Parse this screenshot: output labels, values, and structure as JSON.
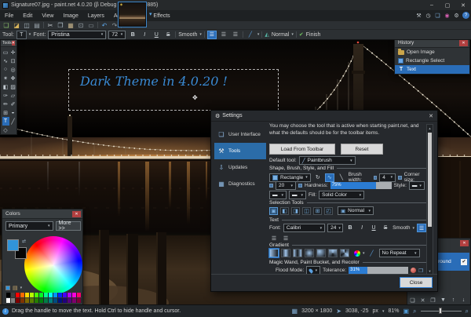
{
  "titlebar": {
    "title": "Signature07.jpg - paint.net 4.0.20 (β Debug 4.20.6554.3885)",
    "minimize": "–",
    "maximize": "▢",
    "close": "✕"
  },
  "tab": {
    "unsaved": "✶",
    "chevron": "▾"
  },
  "menu": {
    "items": [
      "File",
      "Edit",
      "View",
      "Image",
      "Layers",
      "Adjustments",
      "Effects"
    ]
  },
  "utility": {
    "glyphs": [
      "⚒",
      "◷",
      "❏",
      "◉",
      "⚙",
      "?"
    ]
  },
  "toolbar": {
    "glyphs": [
      "❏",
      "◪",
      "◫",
      "▤",
      "✂",
      "❐",
      "▦",
      "⊡",
      "▭",
      "↶",
      "↷",
      "■",
      "⊤"
    ]
  },
  "tool_options": {
    "tool_label": "Tool:",
    "tool_glyph": "T",
    "dd": "▾",
    "font_label": "Font:",
    "font_name": "Pristina",
    "font_size": "72",
    "bold": "B",
    "italic": "I",
    "underline": "U",
    "strike": "S",
    "smooth": "Smooth",
    "align_glyph": "☰",
    "pen_glyph": "╱",
    "blend_glyph": "◭",
    "blend": "Normal",
    "finish_check": "✔",
    "finish": "Finish"
  },
  "canvas": {
    "text": "Dark Theme in 4.0.20 !",
    "handle": "✥"
  },
  "tools_panel": {
    "title": "Tools",
    "close": "✕",
    "glyphs": [
      "▭",
      "✛",
      "∿",
      "⊡",
      "○",
      "◎",
      "✶",
      "✥",
      "◧",
      "▨",
      "✑",
      "▱",
      "✏",
      "✐",
      "⊞",
      "◒",
      "T",
      "╱",
      "◇",
      ""
    ]
  },
  "history": {
    "title": "History",
    "close": "✕",
    "items": [
      "Open Image",
      "Rectangle Select",
      "Text"
    ]
  },
  "colors": {
    "title": "Colors",
    "close": "✕",
    "mode": "Primary",
    "more": "More >>",
    "swap_glyph": "⇄",
    "book_glyph": "▤",
    "dd": "▾",
    "palette": [
      "#000000",
      "#404040",
      "#ff0000",
      "#ff6a00",
      "#ffd800",
      "#b6ff00",
      "#4cff00",
      "#00ff21",
      "#00ff90",
      "#00ffff",
      "#0094ff",
      "#0026ff",
      "#4800ff",
      "#b200ff",
      "#ff00dc",
      "#ff006e"
    ],
    "palette2": [
      "#ffffff",
      "#808080",
      "#7f0000",
      "#7f3300",
      "#7f6a00",
      "#5b7f00",
      "#267f00",
      "#007f0e",
      "#007f46",
      "#007f7f",
      "#004a7f",
      "#00137f",
      "#21007f",
      "#57007f",
      "#7f006e",
      "#7f0037"
    ]
  },
  "layers": {
    "close": "✕",
    "layer_label": "Background",
    "check": "✔",
    "glyphs": [
      "❏",
      "✕",
      "❐",
      "▼",
      "↑",
      "↓",
      "✐"
    ]
  },
  "settings": {
    "title": "Settings",
    "title_icon": "⚙",
    "close": "✕",
    "nav": [
      "User Interface",
      "Tools",
      "Updates",
      "Diagnostics"
    ],
    "nav_icons": [
      "❏",
      "⚒",
      "⇩",
      "▦"
    ],
    "intro": "You may choose the tool that is active when starting paint.net, and what the defaults should be for the toolbar items.",
    "load_btn": "Load From Toolbar",
    "reset_btn": "Reset",
    "default_tool_label": "Default tool:",
    "default_tool_glyph": "╱",
    "default_tool": "Paintbrush",
    "dd": "▾",
    "groups": {
      "shape": "Shape, Brush, Style, and Fill",
      "selection": "Selection Tools",
      "text": "Text",
      "gradient": "Gradient",
      "magic": "Magic Wand, Paint Bucket, and Recolor"
    },
    "shape": {
      "shape_name": "Rectangle",
      "draw_glyph": "↻",
      "curve1": "∿",
      "curve2": "╲",
      "brush_width_label": "Brush width:",
      "brush_width": "4",
      "corner_label": "Corner size:",
      "corner": "20",
      "hardness_label": "Hardness:",
      "hardness_text": "75%",
      "hardness_pct": 75,
      "style_label": "Style:",
      "style_glyph": "▬",
      "dash1": "▬",
      "dash2": "▬",
      "fill_label": "Fill:",
      "fill_value": "Solid Color"
    },
    "selection": {
      "glyphs": [
        "▣",
        "◧",
        "◨",
        "◫",
        "⊞",
        "◰"
      ],
      "mode_glyph": "▣",
      "mode": "Normal"
    },
    "text": {
      "font_label": "Font:",
      "font": "Calibri",
      "size": "24",
      "bold": "B",
      "italic": "I",
      "underline": "U",
      "strike": "S",
      "smooth": "Smooth",
      "align_glyph": "☰"
    },
    "gradient": {
      "line_glyph": "╱",
      "repeat": "No Repeat"
    },
    "magic": {
      "flood_label": "Flood Mode:",
      "tolerance_label": "Tolerance:",
      "tolerance_text": "31%",
      "tolerance_pct": 31,
      "sample_glyph": "❐"
    },
    "scroll_up": "▲",
    "scroll_dn": "▼",
    "close_btn": "Close"
  },
  "statusbar": {
    "info": "i",
    "message": "Drag the handle to move the text. Hold Ctrl to hide handle and cursor.",
    "size_icon": "▦",
    "size": "3200 × 1800",
    "pos_icon": "➤",
    "pos": "3038, -25",
    "unit": "px",
    "dd": "▾",
    "zoom": "81%",
    "fit_icon": "▣",
    "zoom_out": "⌕",
    "zoom_in": "⌕"
  }
}
